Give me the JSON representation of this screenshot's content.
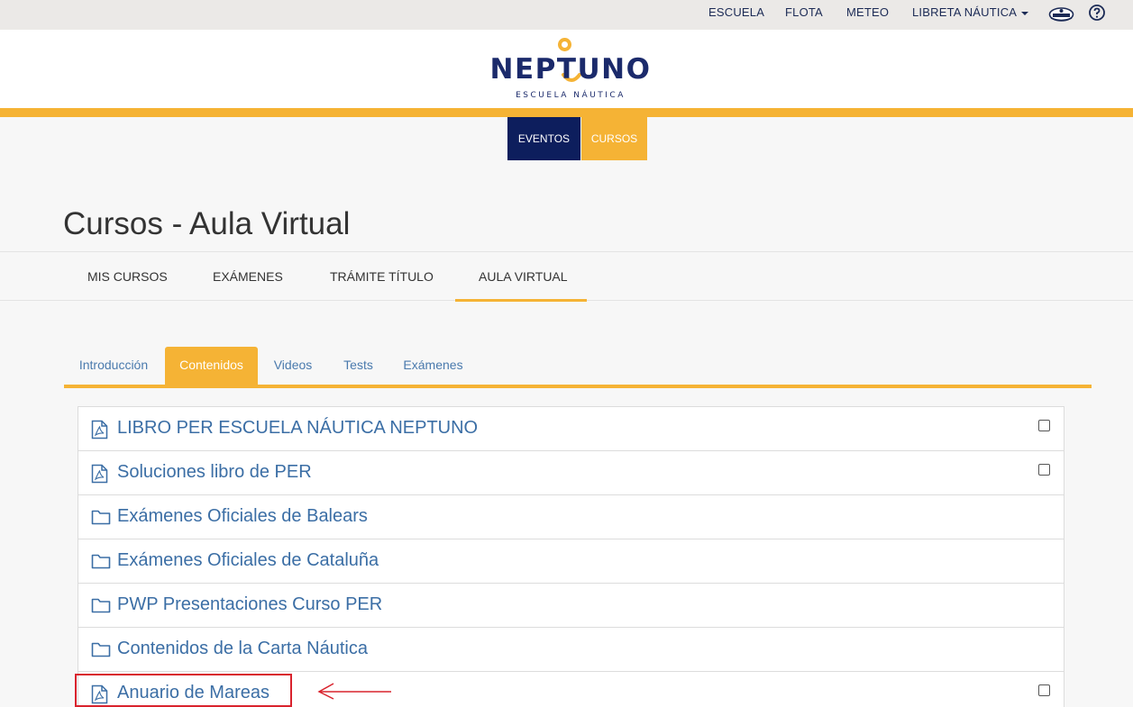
{
  "topbar": {
    "links": [
      "ESCUELA",
      "FLOTA",
      "METEO",
      "LIBRETA NÁUTICA"
    ],
    "icons": [
      "captain-hat-icon",
      "help-circle-icon"
    ]
  },
  "logo": {
    "name": "NEPTUNO",
    "subtitle": "ESCUELA NÁUTICA"
  },
  "colors": {
    "accent": "#f5b335",
    "navy": "#0d1e5d",
    "link": "#3b6ea5",
    "annotation": "#d9232d"
  },
  "main_buttons": {
    "eventos": "EVENTOS",
    "cursos": "CURSOS"
  },
  "page_title": "Cursos - Aula Virtual",
  "subnav": {
    "items": [
      "MIS CURSOS",
      "EXÁMENES",
      "TRÁMITE TÍTULO",
      "AULA VIRTUAL"
    ],
    "active": "AULA VIRTUAL"
  },
  "tabs": {
    "items": [
      "Introducción",
      "Contenidos",
      "Videos",
      "Tests",
      "Exámenes"
    ],
    "active": "Contenidos"
  },
  "contents": [
    {
      "icon": "pdf-file-icon",
      "label": "LIBRO PER ESCUELA NÁUTICA NEPTUNO",
      "checkbox": true,
      "checked": false
    },
    {
      "icon": "pdf-file-icon",
      "label": "Soluciones libro de PER",
      "checkbox": true,
      "checked": false
    },
    {
      "icon": "folder-icon",
      "label": "Exámenes Oficiales de Balears",
      "checkbox": false
    },
    {
      "icon": "folder-icon",
      "label": "Exámenes Oficiales de Cataluña",
      "checkbox": false
    },
    {
      "icon": "folder-icon",
      "label": "PWP Presentaciones Curso PER",
      "checkbox": false
    },
    {
      "icon": "folder-icon",
      "label": "Contenidos de la Carta Náutica",
      "checkbox": false
    },
    {
      "icon": "pdf-file-icon",
      "label": "Anuario de Mareas",
      "checkbox": true,
      "checked": false
    }
  ]
}
